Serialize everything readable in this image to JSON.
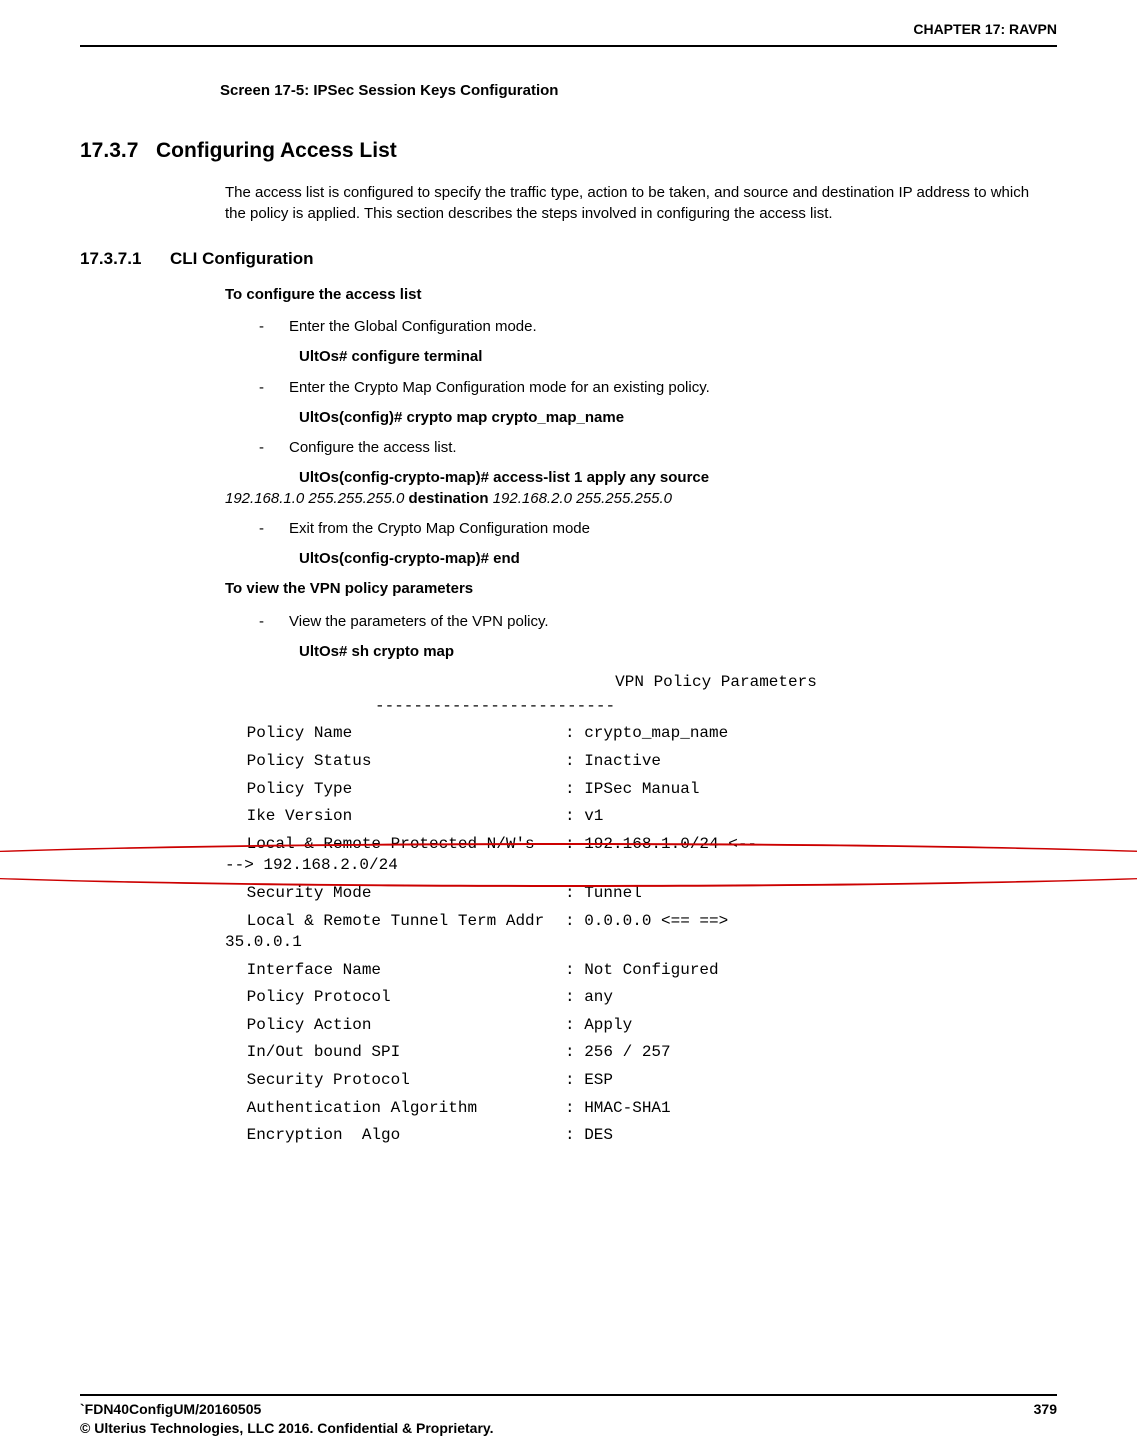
{
  "header": {
    "chapter": "CHAPTER 17: RAVPN"
  },
  "screen_caption": "Screen 17-5: IPSec Session Keys Configuration",
  "section": {
    "number": "17.3.7",
    "title": "Configuring Access List"
  },
  "intro": "The access list is configured to specify the traffic type, action to be taken, and source and destination IP address to which the policy is applied. This section describes the steps involved in configuring the access list.",
  "subsection": {
    "number": "17.3.7.1",
    "title": "CLI Configuration"
  },
  "configure": {
    "heading": "To configure the access list",
    "steps": [
      {
        "text": "Enter the Global Configuration mode.",
        "cmd": "UltOs# configure terminal"
      },
      {
        "text": "Enter the Crypto Map Configuration mode for an existing policy.",
        "cmd": "UltOs(config)# crypto map crypto_map_name"
      },
      {
        "text": "Configure the access list.",
        "cmd_parts": {
          "p1": "UltOs(config-crypto-map)# access-list 1 apply any source",
          "p2": "192.168.1.0 255.255.255.0",
          "p3": " destination ",
          "p4": "192.168.2.0 255.255.255.0"
        }
      },
      {
        "text": "Exit from the Crypto Map Configuration mode",
        "cmd": "UltOs(config-crypto-map)# end"
      }
    ]
  },
  "view": {
    "heading": "To view the VPN policy parameters",
    "step": "View the parameters of the VPN policy.",
    "cmd": "UltOs# sh crypto map"
  },
  "output": {
    "title": "VPN Policy Parameters",
    "dash": "-------------------------",
    "rows": [
      {
        "k": " Policy Name",
        "v": ": crypto_map_name"
      },
      {
        "k": " Policy Status",
        "v": ": Inactive"
      },
      {
        "k": " Policy Type",
        "v": ": IPSec Manual"
      },
      {
        "k": " Ike Version",
        "v": ": v1"
      }
    ],
    "local_remote_nw": {
      "key": " Local & Remote Protected N/W's",
      "val": ": 192.168.1.0/24 <--",
      "cont": "--> 192.168.2.0/24"
    },
    "rows2": [
      {
        "k": " Security Mode",
        "v": ": Tunnel"
      }
    ],
    "tunnel_term": {
      "key": " Local & Remote Tunnel Term Addr",
      "val": ": 0.0.0.0 <== ==>",
      "cont": "35.0.0.1"
    },
    "rows3": [
      {
        "k": " Interface Name",
        "v": ": Not Configured"
      },
      {
        "k": " Policy Protocol",
        "v": ": any"
      },
      {
        "k": " Policy Action",
        "v": ": Apply"
      },
      {
        "k": " In/Out bound SPI",
        "v": ": 256 / 257"
      },
      {
        "k": " Security Protocol",
        "v": ": ESP"
      },
      {
        "k": " Authentication Algorithm",
        "v": ": HMAC-SHA1"
      },
      {
        "k": " Encryption  Algo",
        "v": ": DES"
      }
    ]
  },
  "footer": {
    "doc_id": "`FDN40ConfigUM/20160505",
    "copyright": "© Ulterius Technologies, LLC 2016. Confidential & Proprietary.",
    "page": "379"
  }
}
